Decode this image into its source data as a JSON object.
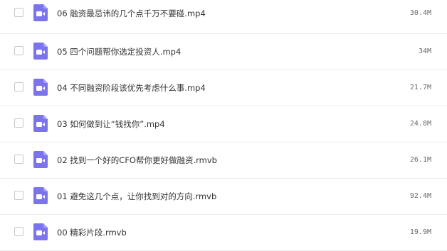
{
  "files": [
    {
      "name": "06 融资最忌讳的几个点千万不要碰.mp4",
      "size": "30.4M",
      "icon": "video-file-icon"
    },
    {
      "name": "05 四个问题帮你选定投资人.mp4",
      "size": "34M",
      "icon": "video-file-icon"
    },
    {
      "name": "04 不同融资阶段该优先考虑什么事.mp4",
      "size": "21.7M",
      "icon": "video-file-icon"
    },
    {
      "name": "03 如何做到让“钱找你”.mp4",
      "size": "24.8M",
      "icon": "video-file-icon"
    },
    {
      "name": "02 找到一个好的CFO帮你更好做融资.rmvb",
      "size": "26.1M",
      "icon": "video-file-icon"
    },
    {
      "name": "01 避免这几个点，让你找到对的方向.rmvb",
      "size": "92.4M",
      "icon": "video-file-icon"
    },
    {
      "name": "00 精彩片段.rmvb",
      "size": "19.9M",
      "icon": "video-file-icon"
    }
  ],
  "colors": {
    "icon_bg": "#7b74ee",
    "icon_fold": "#a7a2f6",
    "icon_glyph": "#ffffff",
    "row_divider": "#ececec"
  }
}
